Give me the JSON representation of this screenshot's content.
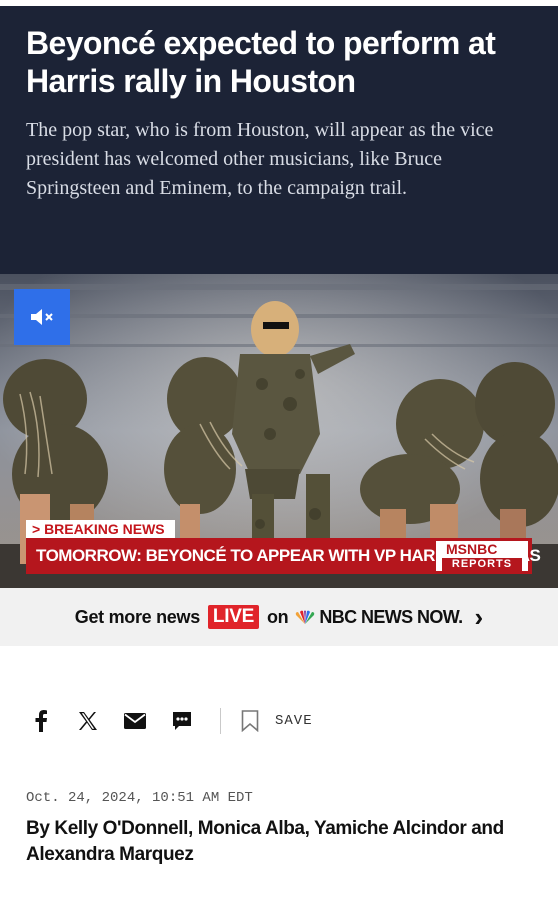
{
  "article": {
    "headline": "Beyoncé expected to perform at Harris rally in Houston",
    "dek": "The pop star, who is from Houston, will appear as the vice president has welcomed other musicians, like Bruce Springsteen and Eminem, to the campaign trail."
  },
  "video": {
    "mute_icon": "speaker-muted-icon",
    "lower_third": {
      "breaking_label": "> BREAKING NEWS",
      "text": "TOMORROW: BEYONCÉ TO APPEAR WITH VP HARRIS IN TEXAS",
      "network": "MSNBC",
      "network_sub": "REPORTS"
    },
    "colors": {
      "lower_third_red": "#b5161d",
      "mute_button": "#2f6fe9"
    }
  },
  "promo": {
    "prefix": "Get more news",
    "live_badge": "LIVE",
    "connector": "on",
    "brand": "NBC NEWS NOW.",
    "chevron_icon": "chevron-right-icon"
  },
  "share_bar": {
    "icons": [
      "facebook-icon",
      "x-icon",
      "email-icon",
      "comment-icon",
      "bookmark-icon"
    ],
    "save_label": "SAVE"
  },
  "meta": {
    "date": "Oct. 24, 2024, 10:51 AM EDT",
    "byline": "By Kelly O'Donnell, Monica Alba, Yamiche Alcindor and Alexandra Marquez"
  },
  "colors": {
    "hero_bg": "#1c2336",
    "live_red": "#e0242a"
  }
}
